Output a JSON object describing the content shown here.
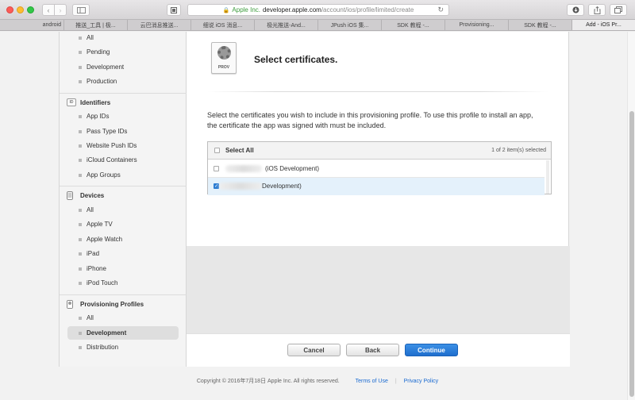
{
  "browser": {
    "address": {
      "ev_name": "Apple Inc.",
      "host": "developer.apple.com",
      "path": "/account/ios/profile/limited/create"
    },
    "tabs": [
      {
        "label": "android"
      },
      {
        "label": "推送_工具 | 极..."
      },
      {
        "label": "云巴消息推送..."
      },
      {
        "label": "细说 iOS 消息..."
      },
      {
        "label": "极光推送-And..."
      },
      {
        "label": "JPush iOS 集..."
      },
      {
        "label": "SDK 教程 -..."
      },
      {
        "label": "Provisioning..."
      },
      {
        "label": "SDK 教程 -..."
      },
      {
        "label": "Add - iOS Pr..."
      }
    ]
  },
  "sidebar": {
    "top_items": [
      {
        "label": "All"
      },
      {
        "label": "Pending"
      },
      {
        "label": "Development"
      },
      {
        "label": "Production"
      }
    ],
    "identifiers": {
      "icon_text": "ID",
      "heading": "Identifiers",
      "items": [
        {
          "label": "App IDs"
        },
        {
          "label": "Pass Type IDs"
        },
        {
          "label": "Website Push IDs"
        },
        {
          "label": "iCloud Containers"
        },
        {
          "label": "App Groups"
        }
      ]
    },
    "devices": {
      "heading": "Devices",
      "items": [
        {
          "label": "All"
        },
        {
          "label": "Apple TV"
        },
        {
          "label": "Apple Watch"
        },
        {
          "label": "iPad"
        },
        {
          "label": "iPhone"
        },
        {
          "label": "iPod Touch"
        }
      ]
    },
    "profiles": {
      "heading": "Provisioning Profiles",
      "items": [
        {
          "label": "All"
        },
        {
          "label": "Development"
        },
        {
          "label": "Distribution"
        }
      ]
    }
  },
  "main": {
    "icon_label": "PROV",
    "title": "Select certificates.",
    "description": "Select the certificates you wish to include in this provisioning profile. To use this profile to install an app, the certificate the app was signed with must be included.",
    "table": {
      "select_all": "Select All",
      "count": "1  of 2 item(s) selected",
      "rows": [
        {
          "label": "(iOS Development)",
          "checked": false
        },
        {
          "label": "Development)",
          "checked": true
        }
      ]
    },
    "buttons": {
      "cancel": "Cancel",
      "back": "Back",
      "continue": "Continue"
    }
  },
  "footer": {
    "copyright": "Copyright © 2016年7月18日 Apple Inc. All rights reserved.",
    "terms": "Terms of Use",
    "separator": "|",
    "privacy": "Privacy Policy"
  },
  "colors": {
    "accent": "#1f6fce",
    "link": "#1a6ad1",
    "selected_row": "#e4f1fb"
  }
}
